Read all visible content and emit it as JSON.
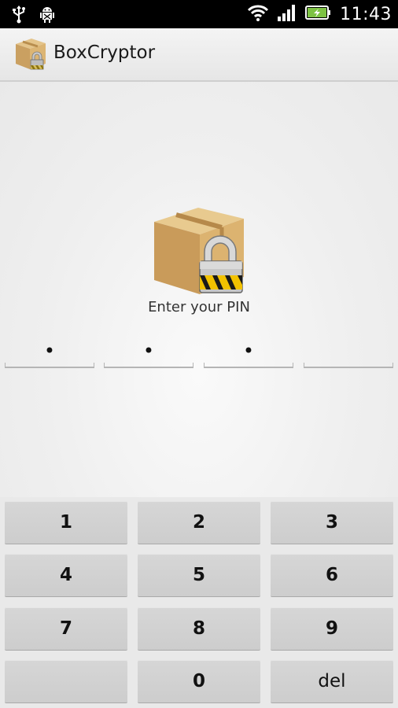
{
  "status_bar": {
    "time": "11:43",
    "icons": [
      "usb-icon",
      "android-debug-icon",
      "wifi-icon",
      "signal-icon",
      "battery-charging-icon"
    ]
  },
  "app_bar": {
    "title": "BoxCryptor",
    "icon": "boxcryptor-logo-icon"
  },
  "pin": {
    "prompt": "Enter your PIN",
    "fields": [
      "•",
      "•",
      "•",
      ""
    ]
  },
  "keypad": {
    "keys": [
      "1",
      "2",
      "3",
      "4",
      "5",
      "6",
      "7",
      "8",
      "9",
      "",
      "0",
      "del"
    ]
  },
  "colors": {
    "status_bar_bg": "#000000",
    "action_bar_bg": "#ececec",
    "key_bg": "#d3d3d3",
    "battery_green": "#7dc243",
    "lock_stripe_yellow": "#f2c200"
  }
}
